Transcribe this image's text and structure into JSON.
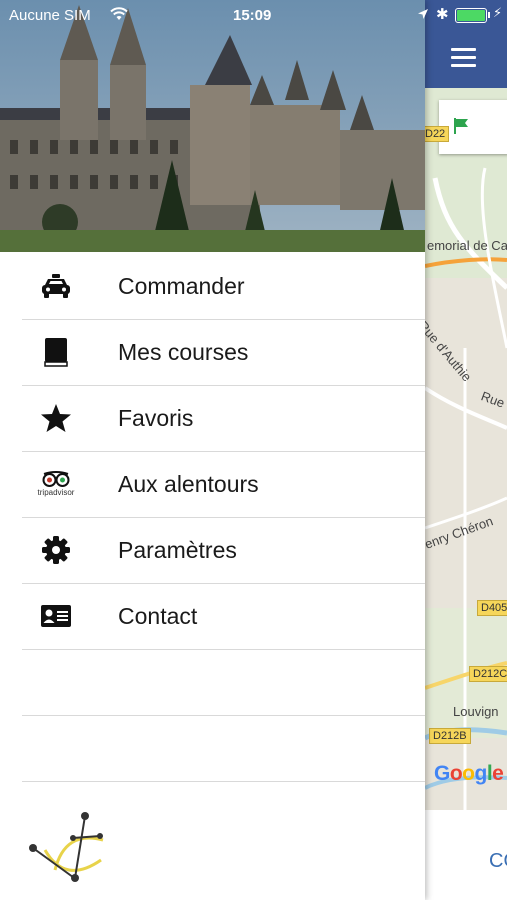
{
  "status_bar": {
    "carrier": "Aucune SIM",
    "time": "15:09"
  },
  "menu": {
    "items": [
      {
        "label": "Commander",
        "icon": "taxi-icon"
      },
      {
        "label": "Mes courses",
        "icon": "book-icon"
      },
      {
        "label": "Favoris",
        "icon": "star-icon"
      },
      {
        "label": "Aux alentours",
        "icon": "tripadvisor-icon"
      },
      {
        "label": "Paramètres",
        "icon": "gear-icon"
      },
      {
        "label": "Contact",
        "icon": "contact-card-icon"
      }
    ]
  },
  "tripadvisor_text": "tripadvisor",
  "map": {
    "labels": {
      "memorial": "emorial de Ca",
      "rue_authie": "Rue d'Authie",
      "rue": "Rue",
      "henry_cheron": "enry Chéron",
      "louvigny": "Louvign"
    },
    "road_badges": {
      "d22": "D22",
      "d405": "D405",
      "d212c": "D212C",
      "d212b": "D212B"
    },
    "google": "Google",
    "bottom_text": "CO"
  },
  "colors": {
    "navbar": "#3a5796",
    "battery": "#4cd964",
    "flag": "#2da44e",
    "accent_link": "#3a6fb4"
  }
}
